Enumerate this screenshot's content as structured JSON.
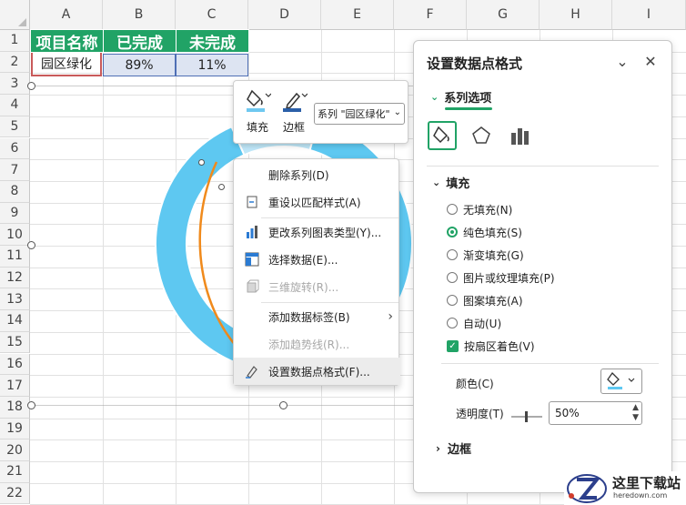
{
  "sheet": {
    "columns": [
      "A",
      "B",
      "C",
      "D",
      "E",
      "F",
      "G",
      "H",
      "I"
    ],
    "rows": [
      "1",
      "2",
      "3",
      "4",
      "5",
      "6",
      "7",
      "8",
      "9",
      "10",
      "11",
      "12",
      "13",
      "14",
      "15",
      "16",
      "17",
      "18",
      "19",
      "20",
      "21",
      "22"
    ],
    "table": {
      "headers": [
        "项目名称",
        "已完成",
        "未完成"
      ],
      "row": [
        "园区绿化",
        "89%",
        "11%"
      ]
    },
    "colors": {
      "header_green": "#21a366",
      "selection_blue": "#dde4f2",
      "ring_blue": "#5ec8f1",
      "ring_light": "#bfe7f8",
      "arrow_orange": "#f08a1c"
    }
  },
  "chart": {
    "type": "doughnut",
    "values": [
      89,
      11
    ]
  },
  "mini_toolbar": {
    "fill_label": "填充",
    "border_label": "边框",
    "series_select": "系列 \"园区绿化\""
  },
  "context_menu": {
    "items": [
      {
        "label": "删除系列(D)",
        "icon": "delete-icon",
        "disabled": false
      },
      {
        "label": "重设以匹配样式(A)",
        "icon": "reset-style-icon",
        "disabled": false
      },
      {
        "label": "更改系列图表类型(Y)...",
        "icon": "chart-type-icon",
        "disabled": false
      },
      {
        "label": "选择数据(E)...",
        "icon": "select-data-icon",
        "disabled": false
      },
      {
        "label": "三维旋转(R)...",
        "icon": "3d-rotate-icon",
        "disabled": true
      },
      {
        "label": "添加数据标签(B)",
        "icon": "",
        "disabled": false
      },
      {
        "label": "添加趋势线(R)...",
        "icon": "",
        "disabled": true
      },
      {
        "label": "设置数据点格式(F)...",
        "icon": "format-point-icon",
        "disabled": false
      }
    ]
  },
  "panel": {
    "title": "设置数据点格式",
    "section": "系列选项",
    "fill_header": "填充",
    "fill_options": [
      "无填充(N)",
      "纯色填充(S)",
      "渐变填充(G)",
      "图片或纹理填充(P)",
      "图案填充(A)",
      "自动(U)"
    ],
    "selected_fill": "纯色填充(S)",
    "vary_by_slice": "按扇区着色(V)",
    "vary_by_slice_checked": true,
    "color_label": "颜色(C)",
    "transparency_label": "透明度(T)",
    "transparency_value": "50%",
    "border_header": "边框"
  },
  "watermark": {
    "text": "这里下载站",
    "sub": "heredown.com"
  }
}
